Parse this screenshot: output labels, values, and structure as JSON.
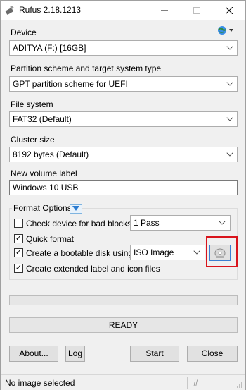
{
  "window": {
    "title": "Rufus 2.18.1213",
    "controls": {
      "minimize": "—",
      "maximize": "☐",
      "close": "✕"
    }
  },
  "device": {
    "label": "Device",
    "value": "ADITYA (F:) [16GB]"
  },
  "partition": {
    "label": "Partition scheme and target system type",
    "value": "GPT partition scheme for UEFI"
  },
  "filesystem": {
    "label": "File system",
    "value": "FAT32 (Default)"
  },
  "cluster": {
    "label": "Cluster size",
    "value": "8192 bytes (Default)"
  },
  "volume": {
    "label": "New volume label",
    "value": "Windows 10 USB"
  },
  "format_options": {
    "legend": "Format Options",
    "bad_blocks": {
      "label": "Check device for bad blocks",
      "checked": false,
      "passes": "1 Pass"
    },
    "quick_format": {
      "label": "Quick format",
      "checked": true
    },
    "bootable": {
      "label": "Create a bootable disk using",
      "checked": true,
      "type": "ISO Image"
    },
    "extended_label": {
      "label": "Create extended label and icon files",
      "checked": true
    }
  },
  "status": {
    "ready": "READY"
  },
  "buttons": {
    "about": "About...",
    "log": "Log",
    "start": "Start",
    "close": "Close"
  },
  "statusbar": {
    "message": "No image selected",
    "hash": "#"
  },
  "icons": {
    "app": "usb-drive-icon",
    "language": "globe-language-icon",
    "disk": "disc-drive-icon"
  },
  "colors": {
    "highlight": "#d9141c",
    "accent": "#3c7fd1"
  }
}
